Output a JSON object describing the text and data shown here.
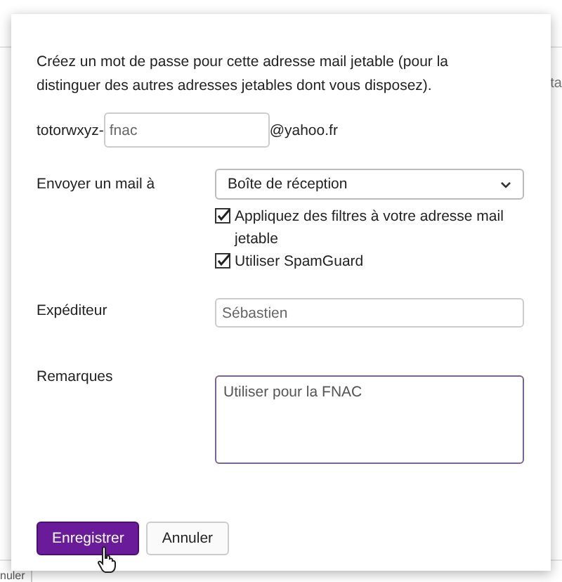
{
  "background": {
    "right_fragment": "ta",
    "bottom_fragment": "nuler"
  },
  "dialog": {
    "intro": "Créez un mot de passe pour cette adresse mail jetable (pour la distinguer des autres adresses jetables dont vous disposez).",
    "address": {
      "prefix": "totorwxyz-",
      "value": "fnac",
      "suffix": "@yahoo.fr"
    },
    "send_to": {
      "label": "Envoyer un mail à",
      "value": "Boîte de réception"
    },
    "options": [
      {
        "label": "Appliquez des filtres à votre adresse mail jetable",
        "checked": true
      },
      {
        "label": "Utiliser SpamGuard",
        "checked": true
      }
    ],
    "sender": {
      "label": "Expéditeur",
      "value": "Sébastien"
    },
    "notes": {
      "label": "Remarques",
      "value": "Utiliser pour la FNAC"
    },
    "buttons": [
      {
        "label": "Enregistrer",
        "kind": "primary"
      },
      {
        "label": "Annuler",
        "kind": "secondary"
      }
    ]
  }
}
